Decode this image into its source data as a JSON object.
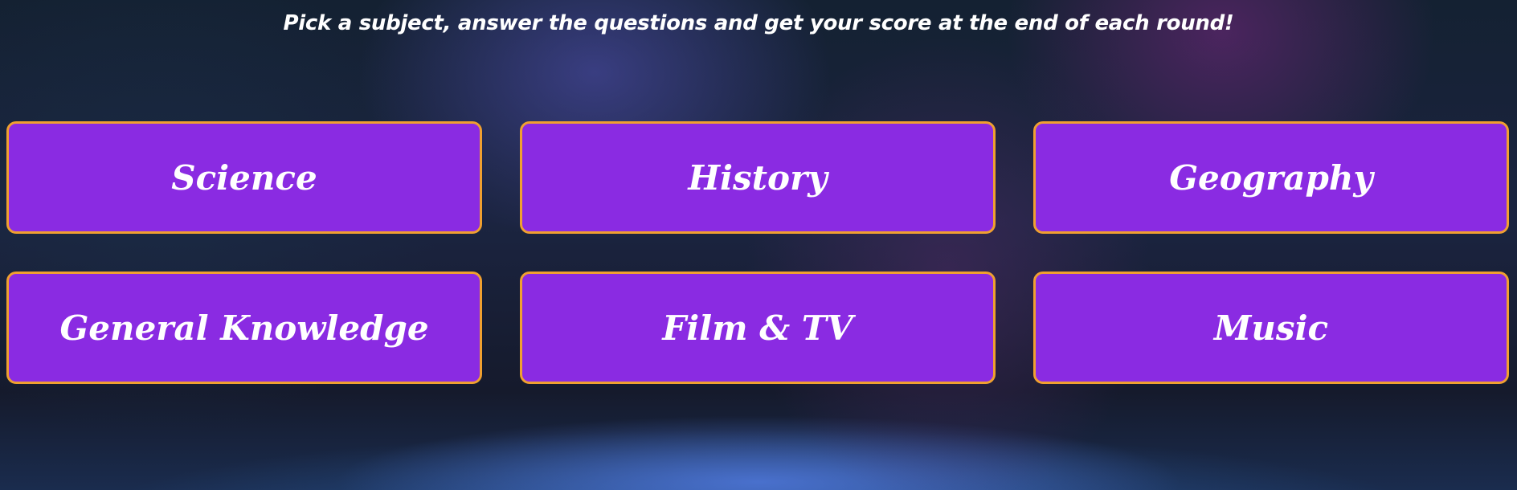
{
  "header": {
    "tagline": "Pick a subject, answer the questions and get your score at the end of each round!"
  },
  "subjects": [
    {
      "label": "Science"
    },
    {
      "label": "History"
    },
    {
      "label": "Geography"
    },
    {
      "label": "General Knowledge"
    },
    {
      "label": "Film & TV"
    },
    {
      "label": "Music"
    }
  ],
  "colors": {
    "button_fill": "#8a2be2",
    "button_border": "#f0a030",
    "text": "#ffffff",
    "background": "#161c33"
  }
}
